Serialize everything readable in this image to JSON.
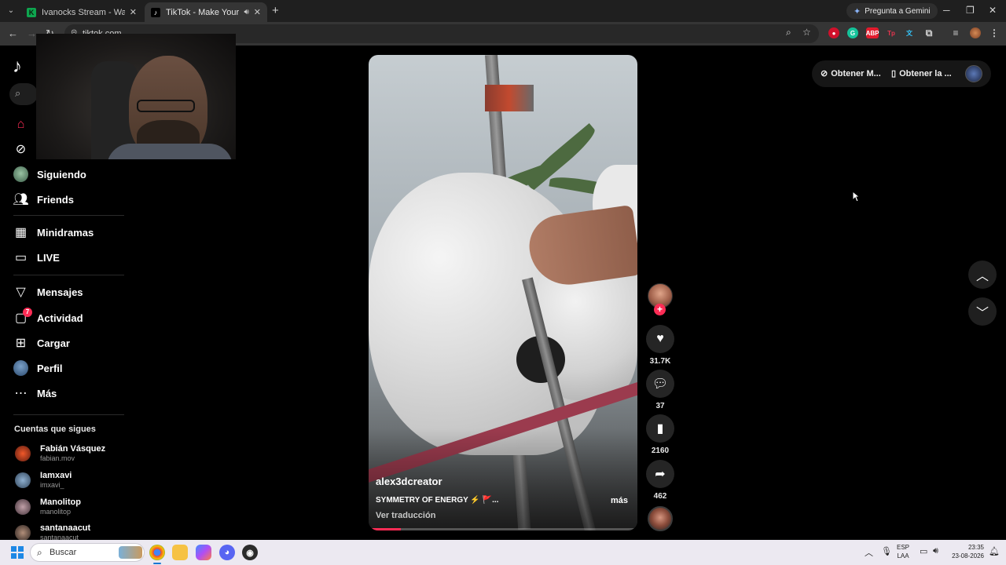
{
  "browser": {
    "tabs": [
      {
        "favicon": "K",
        "title": "Ivanocks Stream - Watch Live o",
        "active": false
      },
      {
        "favicon": "♪",
        "title": "TikTok - Make Your Day",
        "active": true
      }
    ],
    "gemini_label": "Pregunta a Gemini",
    "url": "tiktok.com"
  },
  "sidebar": {
    "items": [
      {
        "name": "home",
        "label": "",
        "icon": "home-icon"
      },
      {
        "name": "explore",
        "label": "",
        "icon": "compass-icon"
      },
      {
        "name": "following",
        "label": "Siguiendo",
        "icon": "avatar"
      },
      {
        "name": "friends",
        "label": "Friends",
        "icon": "people-icon"
      },
      {
        "name": "minidramas",
        "label": "Minidramas",
        "icon": "film-icon"
      },
      {
        "name": "live",
        "label": "LIVE",
        "icon": "tv-icon"
      },
      {
        "name": "messages",
        "label": "Mensajes",
        "icon": "send-icon"
      },
      {
        "name": "activity",
        "label": "Actividad",
        "icon": "inbox-icon",
        "badge": "7"
      },
      {
        "name": "upload",
        "label": "Cargar",
        "icon": "plus-square-icon"
      },
      {
        "name": "profile",
        "label": "Perfil",
        "icon": "avatar"
      },
      {
        "name": "more",
        "label": "Más",
        "icon": "dots-icon"
      }
    ],
    "following_title": "Cuentas que sigues",
    "following": [
      {
        "name": "Fabián Vásquez",
        "handle": "fabian.mov"
      },
      {
        "name": "Iamxavi",
        "handle": "imxavi_"
      },
      {
        "name": "Manolitop",
        "handle": "manolitop"
      },
      {
        "name": "santanaacut",
        "handle": "santanaacut"
      }
    ]
  },
  "topbar": {
    "get_app_1": "Obtener M...",
    "get_app_2": "Obtener la ..."
  },
  "video": {
    "author": "alex3dcreator",
    "description": "SYMMETRY OF ENERGY ⚡ 🚩...",
    "more": "más",
    "translate": "Ver traducción",
    "progress": 0.12
  },
  "actions": {
    "likes": "31.7K",
    "comments": "37",
    "saves": "2160",
    "shares": "462"
  },
  "taskbar": {
    "search_placeholder": "Buscar",
    "lang_top": "ESP",
    "lang_bottom": "LAA",
    "time": "23:35",
    "date": "23-08-2026"
  }
}
